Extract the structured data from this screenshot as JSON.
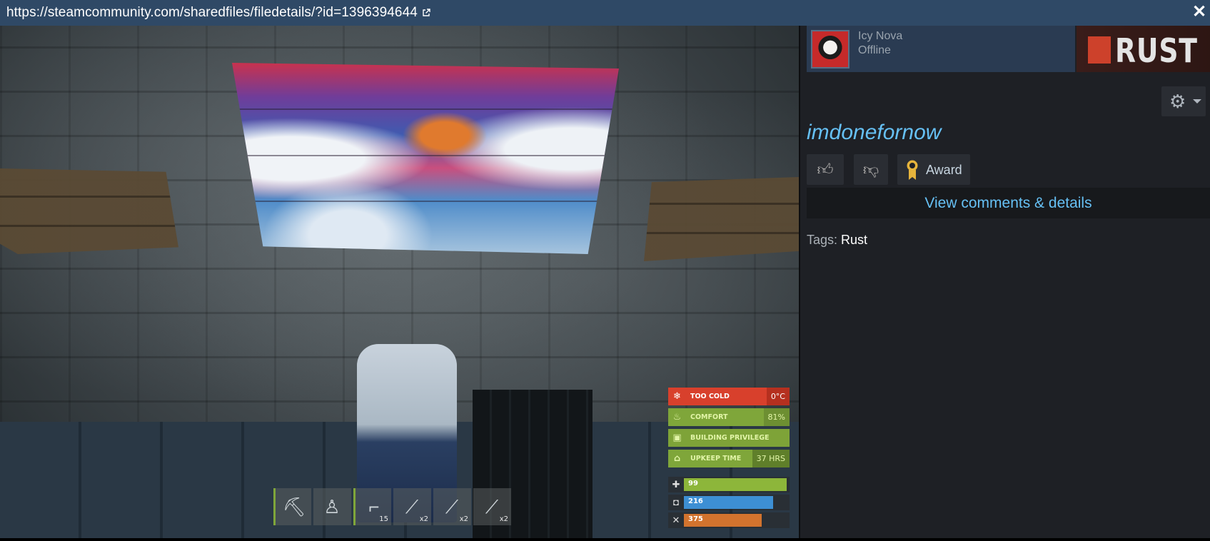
{
  "url_bar": {
    "url": "https://steamcommunity.com/sharedfiles/filedetails/?id=1396394644",
    "external_icon": "external-link-icon",
    "close_glyph": "✕"
  },
  "game_hud": {
    "statuses": [
      {
        "label": "TOO COLD",
        "value": "0°c",
        "icon": "snowflake-icon"
      },
      {
        "label": "COMFORT",
        "value": "81%",
        "icon": "flame-icon"
      },
      {
        "label": "BUILDING PRIVILEGE",
        "value": "",
        "icon": "cube-icon"
      },
      {
        "label": "UPKEEP TIME",
        "value": "37 hrs",
        "icon": "house-icon"
      }
    ],
    "vitals": [
      {
        "name": "health",
        "value": "99",
        "fill": 0.99,
        "color": "#8db63a",
        "icon": "plus-icon"
      },
      {
        "name": "water",
        "value": "216",
        "fill": 0.86,
        "color": "#3d8fd4",
        "icon": "cup-icon"
      },
      {
        "name": "food",
        "value": "375",
        "fill": 0.75,
        "color": "#d2732e",
        "icon": "fork-knife-icon"
      }
    ],
    "hotbar": [
      {
        "item": "pickaxe-icon",
        "qty": ""
      },
      {
        "item": "chair-icon",
        "qty": ""
      },
      {
        "item": "pistol-icon",
        "qty": "15"
      },
      {
        "item": "syringe-icon",
        "qty": "x2"
      },
      {
        "item": "syringe-icon",
        "qty": "x2"
      },
      {
        "item": "syringe-icon",
        "qty": "x2"
      }
    ]
  },
  "panel": {
    "author": {
      "name": "Icy Nova",
      "status": "Offline"
    },
    "game_logo_text": "RUST",
    "item_title": "imdonefornow",
    "award_label": "Award",
    "view_details_label": "View comments & details",
    "tags_label": "Tags:",
    "tags": [
      "Rust"
    ]
  },
  "colors": {
    "url_bar_bg": "#2f4966",
    "panel_bg": "#1e2025",
    "link_blue": "#66c0f4",
    "author_bg": "#2a3b52"
  }
}
